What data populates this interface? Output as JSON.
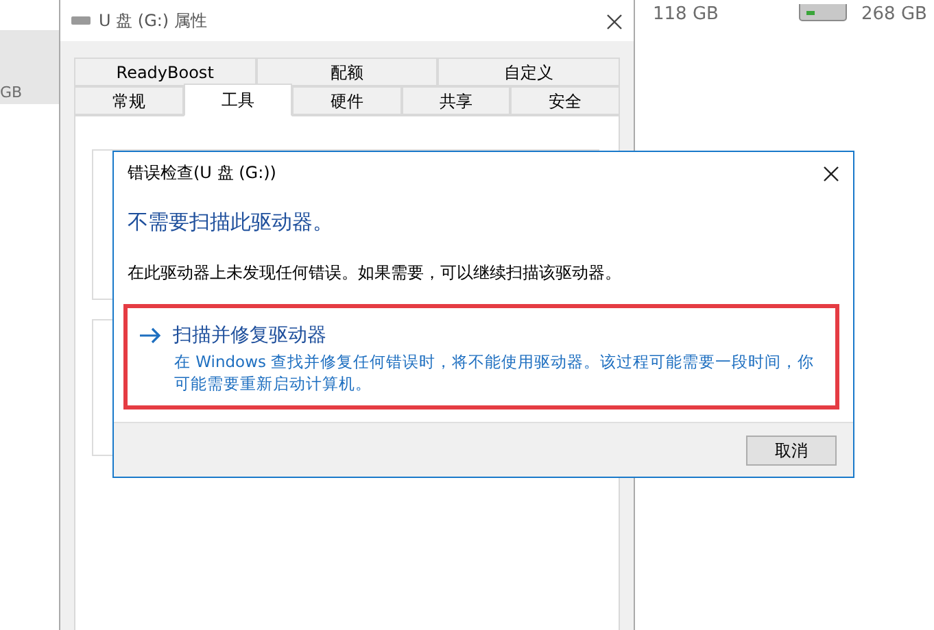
{
  "background": {
    "left_size": "GB",
    "total_size": "118 GB",
    "drive_size": "268 GB"
  },
  "properties_window": {
    "title": "U 盘 (G:) 属性",
    "tab_rows": [
      [
        {
          "label": "ReadyBoost",
          "selected": false
        },
        {
          "label": "配额",
          "selected": false
        },
        {
          "label": "自定义",
          "selected": false
        }
      ],
      [
        {
          "label": "常规",
          "selected": false
        },
        {
          "label": "工具",
          "selected": true
        },
        {
          "label": "硬件",
          "selected": false
        },
        {
          "label": "共享",
          "selected": false
        },
        {
          "label": "安全",
          "selected": false
        }
      ]
    ]
  },
  "dialog": {
    "title": "错误检查(U 盘 (G:))",
    "heading": "不需要扫描此驱动器。",
    "message": "在此驱动器上未发现任何错误。如果需要，可以继续扫描该驱动器。",
    "option": {
      "title": "扫描并修复驱动器",
      "description": "在 Windows 查找并修复任何错误时，将不能使用驱动器。该过程可能需要一段时间，你可能需要重新启动计算机。",
      "highlighted": true
    },
    "buttons": [
      "取消"
    ]
  }
}
